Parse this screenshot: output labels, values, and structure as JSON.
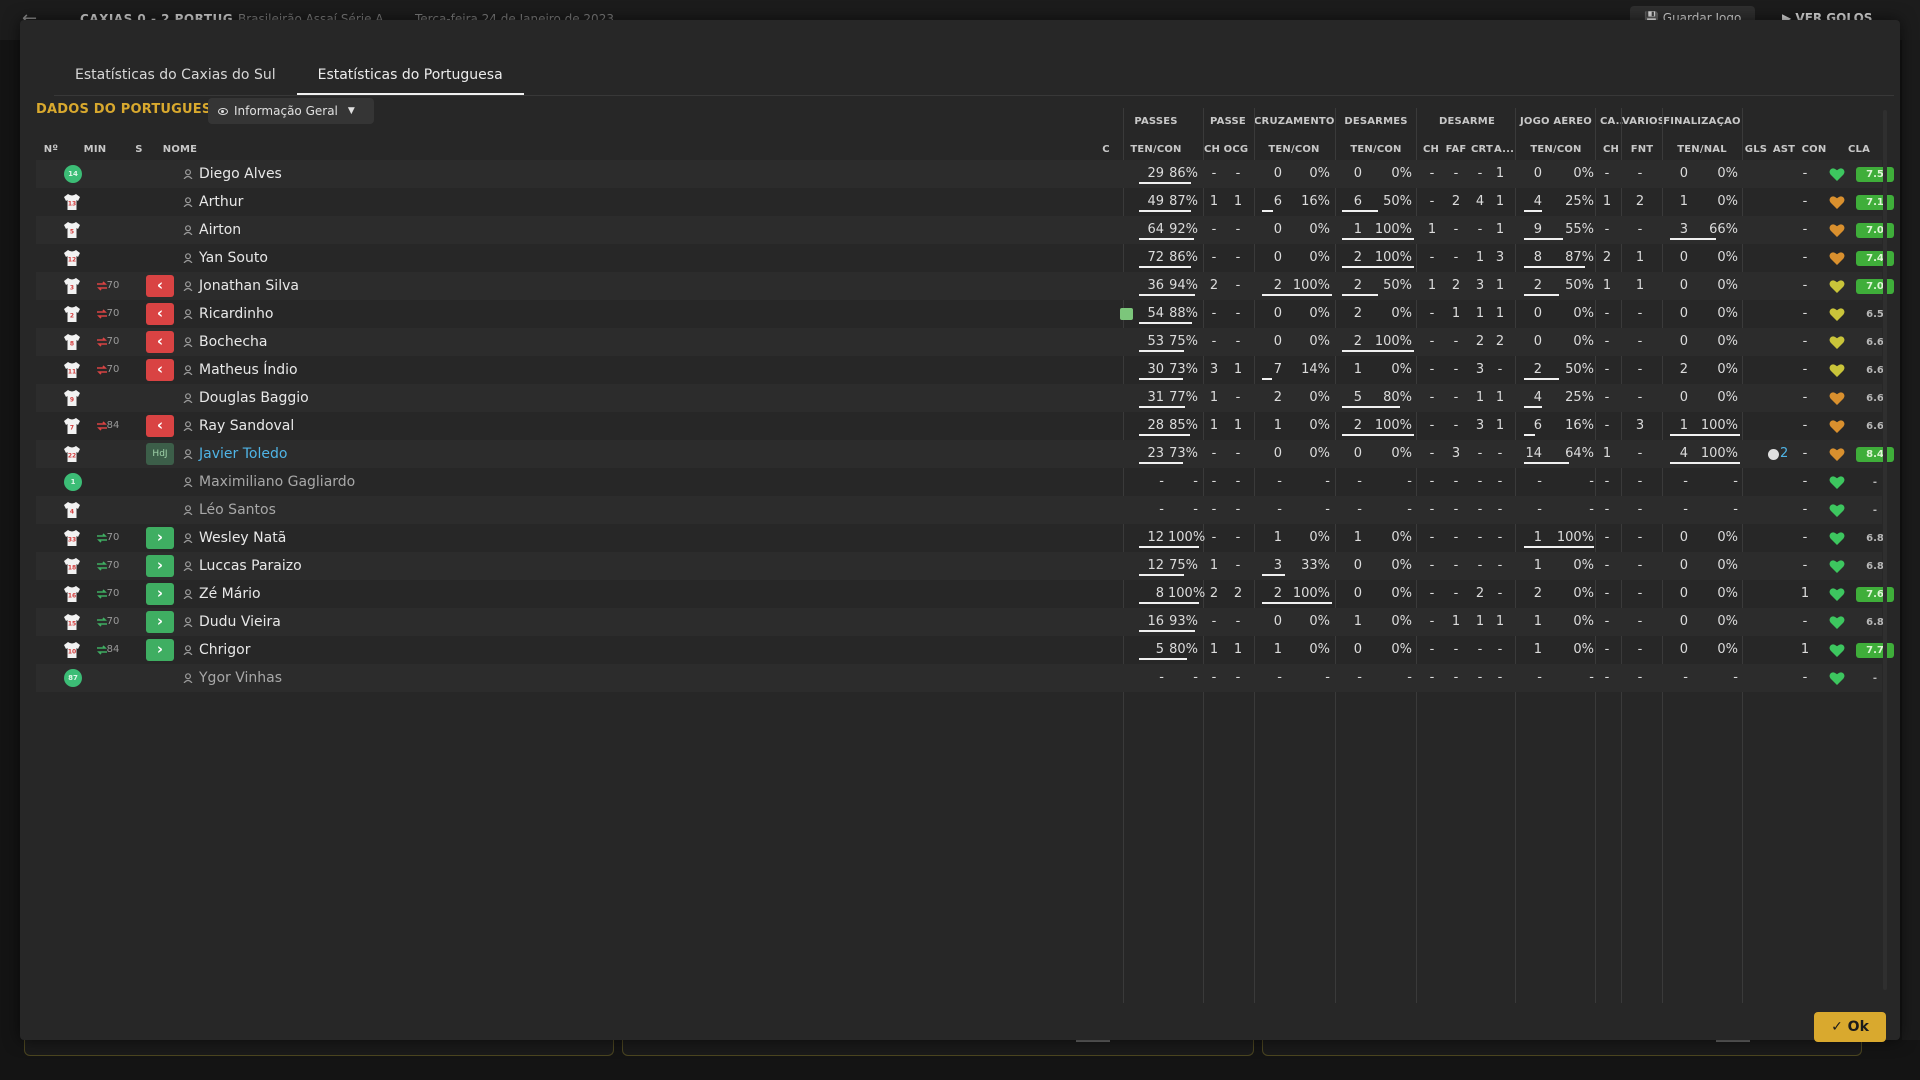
{
  "background": {
    "score": "CAXIAS  0 - 2  PORTUG",
    "competition": "Brasileirão Assaí Série A",
    "date": "Terça-feira 24 de Janeiro de 2023",
    "save_label": "Guardar Jogo",
    "goals_label": "VER GOLOS"
  },
  "tabs": [
    {
      "label": "Estatísticas do Caxias do Sul",
      "active": false
    },
    {
      "label": "Estatísticas do Portuguesa",
      "active": true
    }
  ],
  "section_title": "DADOS DO PORTUGUESA",
  "view_select": {
    "value": "Informação Geral"
  },
  "groups": {
    "passes": "PASSES",
    "passe": "PASSE",
    "cross": "CRUZAMENTOS",
    "tackles": "DESARMES",
    "desarme": "DESARME",
    "aerial": "JOGO AÉREO",
    "ca": "CA...",
    "various": "VÁRIOS",
    "finish": "FINALIZAÇÃO"
  },
  "columns": {
    "no": "Nº",
    "min": "MIN",
    "s": "S",
    "name": "NOME",
    "c": "C",
    "pass_tc": "TEN/CON",
    "pass_ch": "CH",
    "pass_ocg": "OCG",
    "cross_tc": "TEN/CON",
    "tackle_tc": "TEN/CON",
    "d_ch": "CH",
    "d_faf": "FAF",
    "d_crt": "CRT",
    "d_a": "A...",
    "aerial_tc": "TEN/CON",
    "ca_ch": "CH",
    "fnt": "FNT",
    "finish_tn": "TEN/NAL",
    "gls": "GLS",
    "ast": "AST",
    "con": "CON",
    "cla": "CLA"
  },
  "players": [
    {
      "no": "14",
      "gk": true,
      "min": "",
      "sub": "",
      "name": "Diego Alves",
      "card": false,
      "passes": "29",
      "passes_pct": "86%",
      "p_ch": "-",
      "p_ocg": "-",
      "cross": "0",
      "cross_pct": "0%",
      "tackles": "0",
      "tackles_pct": "0%",
      "d_ch": "-",
      "d_faf": "-",
      "d_crt": "-",
      "d_a": "1",
      "aer": "0",
      "aer_pct": "0%",
      "ca_ch": "-",
      "fnt": "-",
      "fin": "0",
      "fin_pct": "0%",
      "gls": "",
      "ast": "-",
      "heart": "green",
      "rating": "7.5",
      "rating_style": "g",
      "pass_fill": 0.86,
      "cross_fill": 0,
      "tackle_fill": 0,
      "aer_fill": 0,
      "fin_fill": 0
    },
    {
      "no": "13",
      "gk": false,
      "min": "",
      "sub": "",
      "name": "Arthur",
      "card": false,
      "passes": "49",
      "passes_pct": "87%",
      "p_ch": "1",
      "p_ocg": "1",
      "cross": "6",
      "cross_pct": "16%",
      "tackles": "6",
      "tackles_pct": "50%",
      "d_ch": "-",
      "d_faf": "2",
      "d_crt": "4",
      "d_a": "1",
      "aer": "4",
      "aer_pct": "25%",
      "ca_ch": "1",
      "fnt": "2",
      "fin": "1",
      "fin_pct": "0%",
      "gls": "",
      "ast": "-",
      "heart": "orange",
      "rating": "7.1",
      "rating_style": "g",
      "pass_fill": 0.87,
      "cross_fill": 0.16,
      "tackle_fill": 0.5,
      "aer_fill": 0.25,
      "fin_fill": 0
    },
    {
      "no": "5",
      "gk": false,
      "min": "",
      "sub": "",
      "name": "Airton",
      "card": false,
      "passes": "64",
      "passes_pct": "92%",
      "p_ch": "-",
      "p_ocg": "-",
      "cross": "0",
      "cross_pct": "0%",
      "tackles": "1",
      "tackles_pct": "100%",
      "d_ch": "1",
      "d_faf": "-",
      "d_crt": "-",
      "d_a": "1",
      "aer": "9",
      "aer_pct": "55%",
      "ca_ch": "-",
      "fnt": "-",
      "fin": "3",
      "fin_pct": "66%",
      "gls": "",
      "ast": "-",
      "heart": "orange",
      "rating": "7.0",
      "rating_style": "g",
      "pass_fill": 0.92,
      "cross_fill": 0,
      "tackle_fill": 1,
      "aer_fill": 0.55,
      "fin_fill": 0.66
    },
    {
      "no": "12",
      "gk": false,
      "min": "",
      "sub": "",
      "name": "Yan Souto",
      "card": false,
      "passes": "72",
      "passes_pct": "86%",
      "p_ch": "-",
      "p_ocg": "-",
      "cross": "0",
      "cross_pct": "0%",
      "tackles": "2",
      "tackles_pct": "100%",
      "d_ch": "-",
      "d_faf": "-",
      "d_crt": "1",
      "d_a": "3",
      "aer": "8",
      "aer_pct": "87%",
      "ca_ch": "2",
      "fnt": "1",
      "fin": "0",
      "fin_pct": "0%",
      "gls": "",
      "ast": "-",
      "heart": "orange",
      "rating": "7.4",
      "rating_style": "g",
      "pass_fill": 0.86,
      "cross_fill": 0,
      "tackle_fill": 1,
      "aer_fill": 0.87,
      "fin_fill": 0
    },
    {
      "no": "3",
      "gk": false,
      "min": "70",
      "sub": "out",
      "name": "Jonathan Silva",
      "card": false,
      "passes": "36",
      "passes_pct": "94%",
      "p_ch": "2",
      "p_ocg": "-",
      "cross": "2",
      "cross_pct": "100%",
      "tackles": "2",
      "tackles_pct": "50%",
      "d_ch": "1",
      "d_faf": "2",
      "d_crt": "3",
      "d_a": "1",
      "aer": "2",
      "aer_pct": "50%",
      "ca_ch": "1",
      "fnt": "1",
      "fin": "0",
      "fin_pct": "0%",
      "gls": "",
      "ast": "-",
      "heart": "yellow",
      "rating": "7.0",
      "rating_style": "g",
      "pass_fill": 0.94,
      "cross_fill": 1,
      "tackle_fill": 0.5,
      "aer_fill": 0.5,
      "fin_fill": 0
    },
    {
      "no": "2",
      "gk": false,
      "min": "70",
      "sub": "out",
      "name": "Ricardinho",
      "card": true,
      "passes": "54",
      "passes_pct": "88%",
      "p_ch": "-",
      "p_ocg": "-",
      "cross": "0",
      "cross_pct": "0%",
      "tackles": "2",
      "tackles_pct": "0%",
      "d_ch": "-",
      "d_faf": "1",
      "d_crt": "1",
      "d_a": "1",
      "aer": "0",
      "aer_pct": "0%",
      "ca_ch": "-",
      "fnt": "-",
      "fin": "0",
      "fin_pct": "0%",
      "gls": "",
      "ast": "-",
      "heart": "yellow",
      "rating": "6.5",
      "rating_style": "n",
      "pass_fill": 0.88,
      "cross_fill": 0,
      "tackle_fill": 0,
      "aer_fill": 0,
      "fin_fill": 0
    },
    {
      "no": "8",
      "gk": false,
      "min": "70",
      "sub": "out",
      "name": "Bochecha",
      "card": false,
      "passes": "53",
      "passes_pct": "75%",
      "p_ch": "-",
      "p_ocg": "-",
      "cross": "0",
      "cross_pct": "0%",
      "tackles": "2",
      "tackles_pct": "100%",
      "d_ch": "-",
      "d_faf": "-",
      "d_crt": "2",
      "d_a": "2",
      "aer": "0",
      "aer_pct": "0%",
      "ca_ch": "-",
      "fnt": "-",
      "fin": "0",
      "fin_pct": "0%",
      "gls": "",
      "ast": "-",
      "heart": "yellow",
      "rating": "6.6",
      "rating_style": "n",
      "pass_fill": 0.75,
      "cross_fill": 0,
      "tackle_fill": 1,
      "aer_fill": 0,
      "fin_fill": 0
    },
    {
      "no": "11",
      "gk": false,
      "min": "70",
      "sub": "out",
      "name": "Matheus Índio",
      "card": false,
      "passes": "30",
      "passes_pct": "73%",
      "p_ch": "3",
      "p_ocg": "1",
      "cross": "7",
      "cross_pct": "14%",
      "tackles": "1",
      "tackles_pct": "0%",
      "d_ch": "-",
      "d_faf": "-",
      "d_crt": "3",
      "d_a": "-",
      "aer": "2",
      "aer_pct": "50%",
      "ca_ch": "-",
      "fnt": "-",
      "fin": "2",
      "fin_pct": "0%",
      "gls": "",
      "ast": "-",
      "heart": "yellow",
      "rating": "6.6",
      "rating_style": "n",
      "pass_fill": 0.73,
      "cross_fill": 0.14,
      "tackle_fill": 0,
      "aer_fill": 0.5,
      "fin_fill": 0
    },
    {
      "no": "9",
      "gk": false,
      "min": "",
      "sub": "",
      "name": "Douglas Baggio",
      "card": false,
      "passes": "31",
      "passes_pct": "77%",
      "p_ch": "1",
      "p_ocg": "-",
      "cross": "2",
      "cross_pct": "0%",
      "tackles": "5",
      "tackles_pct": "80%",
      "d_ch": "-",
      "d_faf": "-",
      "d_crt": "1",
      "d_a": "1",
      "aer": "4",
      "aer_pct": "25%",
      "ca_ch": "-",
      "fnt": "-",
      "fin": "0",
      "fin_pct": "0%",
      "gls": "",
      "ast": "-",
      "heart": "orange",
      "rating": "6.6",
      "rating_style": "n",
      "pass_fill": 0.77,
      "cross_fill": 0,
      "tackle_fill": 0.8,
      "aer_fill": 0.25,
      "fin_fill": 0
    },
    {
      "no": "7",
      "gk": false,
      "min": "84",
      "sub": "out",
      "name": "Ray Sandoval",
      "card": false,
      "passes": "28",
      "passes_pct": "85%",
      "p_ch": "1",
      "p_ocg": "1",
      "cross": "1",
      "cross_pct": "0%",
      "tackles": "2",
      "tackles_pct": "100%",
      "d_ch": "-",
      "d_faf": "-",
      "d_crt": "3",
      "d_a": "1",
      "aer": "6",
      "aer_pct": "16%",
      "ca_ch": "-",
      "fnt": "3",
      "fin": "1",
      "fin_pct": "100%",
      "gls": "",
      "ast": "-",
      "heart": "orange",
      "rating": "6.6",
      "rating_style": "n",
      "pass_fill": 0.85,
      "cross_fill": 0,
      "tackle_fill": 1,
      "aer_fill": 0.16,
      "fin_fill": 1
    },
    {
      "no": "22",
      "gk": false,
      "min": "",
      "sub": "hdj",
      "hdj_label": "HdJ",
      "name": "Javier Toledo",
      "card": false,
      "potm": true,
      "passes": "23",
      "passes_pct": "73%",
      "p_ch": "-",
      "p_ocg": "-",
      "cross": "0",
      "cross_pct": "0%",
      "tackles": "0",
      "tackles_pct": "0%",
      "d_ch": "-",
      "d_faf": "3",
      "d_crt": "-",
      "d_a": "-",
      "aer": "14",
      "aer_pct": "64%",
      "ca_ch": "1",
      "fnt": "-",
      "fin": "4",
      "fin_pct": "100%",
      "gls": "2",
      "ast": "-",
      "heart": "orange",
      "rating": "8.4",
      "rating_style": "g",
      "pass_fill": 0.73,
      "cross_fill": 0,
      "tackle_fill": 0,
      "aer_fill": 0.64,
      "fin_fill": 1
    },
    {
      "no": "1",
      "gk": true,
      "min": "",
      "sub": "",
      "name": "Maximiliano Gagliardo",
      "dim": true,
      "card": false,
      "passes": "-",
      "passes_pct": "-",
      "p_ch": "-",
      "p_ocg": "-",
      "cross": "-",
      "cross_pct": "-",
      "tackles": "-",
      "tackles_pct": "-",
      "d_ch": "-",
      "d_faf": "-",
      "d_crt": "-",
      "d_a": "-",
      "aer": "-",
      "aer_pct": "-",
      "ca_ch": "-",
      "fnt": "-",
      "fin": "-",
      "fin_pct": "-",
      "gls": "",
      "ast": "-",
      "heart": "green",
      "rating": "-",
      "rating_style": "n",
      "pass_fill": 0,
      "cross_fill": 0,
      "tackle_fill": 0,
      "aer_fill": 0,
      "fin_fill": 0
    },
    {
      "no": "4",
      "gk": false,
      "min": "",
      "sub": "",
      "name": "Léo Santos",
      "dim": true,
      "card": false,
      "passes": "-",
      "passes_pct": "-",
      "p_ch": "-",
      "p_ocg": "-",
      "cross": "-",
      "cross_pct": "-",
      "tackles": "-",
      "tackles_pct": "-",
      "d_ch": "-",
      "d_faf": "-",
      "d_crt": "-",
      "d_a": "-",
      "aer": "-",
      "aer_pct": "-",
      "ca_ch": "-",
      "fnt": "-",
      "fin": "-",
      "fin_pct": "-",
      "gls": "",
      "ast": "-",
      "heart": "green",
      "rating": "-",
      "rating_style": "n",
      "pass_fill": 0,
      "cross_fill": 0,
      "tackle_fill": 0,
      "aer_fill": 0,
      "fin_fill": 0
    },
    {
      "no": "33",
      "gk": false,
      "min": "70",
      "sub": "in",
      "name": "Wesley Natã",
      "card": false,
      "passes": "12",
      "passes_pct": "100%",
      "p_ch": "-",
      "p_ocg": "-",
      "cross": "1",
      "cross_pct": "0%",
      "tackles": "1",
      "tackles_pct": "0%",
      "d_ch": "-",
      "d_faf": "-",
      "d_crt": "-",
      "d_a": "-",
      "aer": "1",
      "aer_pct": "100%",
      "ca_ch": "-",
      "fnt": "-",
      "fin": "0",
      "fin_pct": "0%",
      "gls": "",
      "ast": "-",
      "heart": "green",
      "rating": "6.8",
      "rating_style": "n",
      "pass_fill": 1,
      "cross_fill": 0,
      "tackle_fill": 0,
      "aer_fill": 1,
      "fin_fill": 0
    },
    {
      "no": "18",
      "gk": false,
      "min": "70",
      "sub": "in",
      "name": "Luccas Paraizo",
      "card": false,
      "passes": "12",
      "passes_pct": "75%",
      "p_ch": "1",
      "p_ocg": "-",
      "cross": "3",
      "cross_pct": "33%",
      "tackles": "0",
      "tackles_pct": "0%",
      "d_ch": "-",
      "d_faf": "-",
      "d_crt": "-",
      "d_a": "-",
      "aer": "1",
      "aer_pct": "0%",
      "ca_ch": "-",
      "fnt": "-",
      "fin": "0",
      "fin_pct": "0%",
      "gls": "",
      "ast": "-",
      "heart": "green",
      "rating": "6.8",
      "rating_style": "n",
      "pass_fill": 0.75,
      "cross_fill": 0.33,
      "tackle_fill": 0,
      "aer_fill": 0,
      "fin_fill": 0
    },
    {
      "no": "16",
      "gk": false,
      "min": "70",
      "sub": "in",
      "name": "Zé Mário",
      "card": false,
      "passes": "8",
      "passes_pct": "100%",
      "p_ch": "2",
      "p_ocg": "2",
      "cross": "2",
      "cross_pct": "100%",
      "tackles": "0",
      "tackles_pct": "0%",
      "d_ch": "-",
      "d_faf": "-",
      "d_crt": "2",
      "d_a": "-",
      "aer": "2",
      "aer_pct": "0%",
      "ca_ch": "-",
      "fnt": "-",
      "fin": "0",
      "fin_pct": "0%",
      "gls": "",
      "ast": "1",
      "heart": "green",
      "rating": "7.6",
      "rating_style": "g",
      "pass_fill": 1,
      "cross_fill": 1,
      "tackle_fill": 0,
      "aer_fill": 0,
      "fin_fill": 0
    },
    {
      "no": "15",
      "gk": false,
      "min": "70",
      "sub": "in",
      "name": "Dudu Vieira",
      "card": false,
      "passes": "16",
      "passes_pct": "93%",
      "p_ch": "-",
      "p_ocg": "-",
      "cross": "0",
      "cross_pct": "0%",
      "tackles": "1",
      "tackles_pct": "0%",
      "d_ch": "-",
      "d_faf": "1",
      "d_crt": "1",
      "d_a": "1",
      "aer": "1",
      "aer_pct": "0%",
      "ca_ch": "-",
      "fnt": "-",
      "fin": "0",
      "fin_pct": "0%",
      "gls": "",
      "ast": "-",
      "heart": "green",
      "rating": "6.8",
      "rating_style": "n",
      "pass_fill": 0.93,
      "cross_fill": 0,
      "tackle_fill": 0,
      "aer_fill": 0,
      "fin_fill": 0
    },
    {
      "no": "10",
      "gk": false,
      "min": "84",
      "sub": "in",
      "name": "Chrigor",
      "card": false,
      "passes": "5",
      "passes_pct": "80%",
      "p_ch": "1",
      "p_ocg": "1",
      "cross": "1",
      "cross_pct": "0%",
      "tackles": "0",
      "tackles_pct": "0%",
      "d_ch": "-",
      "d_faf": "-",
      "d_crt": "-",
      "d_a": "-",
      "aer": "1",
      "aer_pct": "0%",
      "ca_ch": "-",
      "fnt": "-",
      "fin": "0",
      "fin_pct": "0%",
      "gls": "",
      "ast": "1",
      "heart": "green",
      "rating": "7.7",
      "rating_style": "g",
      "pass_fill": 0.8,
      "cross_fill": 0,
      "tackle_fill": 0,
      "aer_fill": 0,
      "fin_fill": 0
    },
    {
      "no": "87",
      "gk": true,
      "min": "",
      "sub": "",
      "name": "Ygor Vinhas",
      "dim": true,
      "card": false,
      "passes": "-",
      "passes_pct": "-",
      "p_ch": "-",
      "p_ocg": "-",
      "cross": "-",
      "cross_pct": "-",
      "tackles": "-",
      "tackles_pct": "-",
      "d_ch": "-",
      "d_faf": "-",
      "d_crt": "-",
      "d_a": "-",
      "aer": "-",
      "aer_pct": "-",
      "ca_ch": "-",
      "fnt": "-",
      "fin": "-",
      "fin_pct": "-",
      "gls": "",
      "ast": "-",
      "heart": "green",
      "rating": "-",
      "rating_style": "n",
      "pass_fill": 0,
      "cross_fill": 0,
      "tackle_fill": 0,
      "aer_fill": 0,
      "fin_fill": 0
    }
  ],
  "colors": {
    "accent": "#d9a92e",
    "sub_out": "#d94343",
    "sub_in": "#3fae62",
    "heart_green": "#3dc65f",
    "heart_yellow": "#c9c43a",
    "heart_orange": "#d9902e",
    "potm": "#4fb4e6"
  },
  "ok_label": "✓ Ok"
}
